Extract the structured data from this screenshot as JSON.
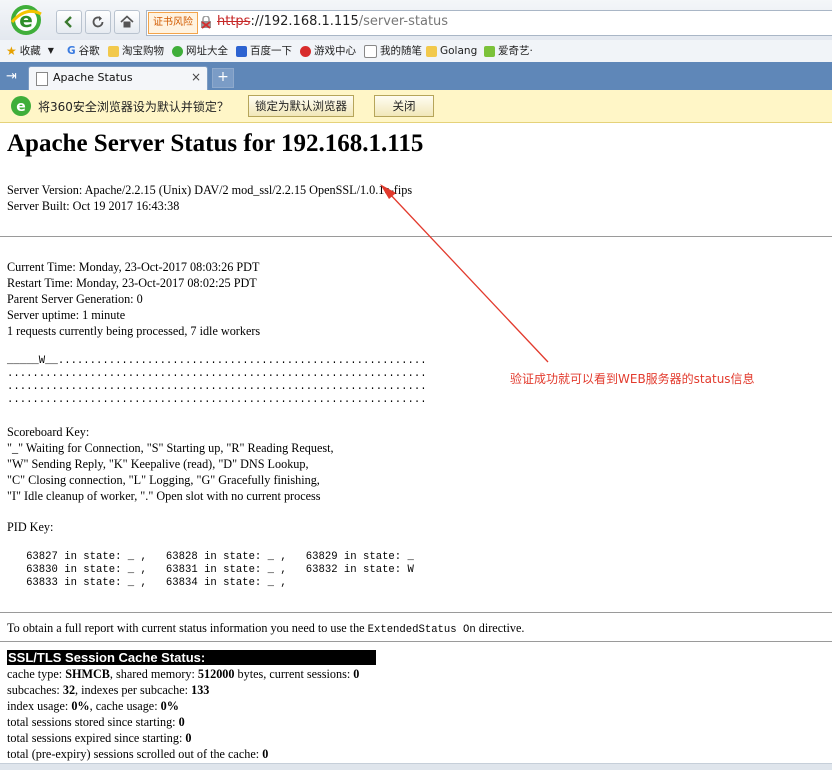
{
  "browser": {
    "cert_warning": "证书风险",
    "url_scheme": "https",
    "url_host": "://192.168.1.115",
    "url_path": "/server-status",
    "bookmarks": [
      "收藏",
      "谷歌",
      "淘宝购物",
      "网址大全",
      "百度一下",
      "游戏中心",
      "我的随笔",
      "Golang",
      "爱奇艺·"
    ],
    "tab_title": "Apache Status",
    "tab_close": "×",
    "new_tab": "+",
    "notify_text": "将360安全浏览器设为默认并锁定？",
    "notify_lock_btn": "锁定为默认浏览器",
    "notify_close_btn": "关闭"
  },
  "page": {
    "title": "Apache Server Status for 192.168.1.115",
    "server_version": "Server Version: Apache/2.2.15 (Unix) DAV/2 mod_ssl/2.2.15 OpenSSL/1.0.1e-fips",
    "server_built": "Server Built: Oct 19 2017 16:43:38",
    "current_time": "Current Time: Monday, 23-Oct-2017 08:03:26 PDT",
    "restart_time": "Restart Time: Monday, 23-Oct-2017 08:02:25 PDT",
    "parent_gen": "Parent Server Generation: 0",
    "uptime": "Server uptime: 1 minute",
    "requests": "1 requests currently being processed, 7 idle workers",
    "scoreboard": [
      "_____W__..........................................................",
      "..................................................................",
      "..................................................................",
      ".................................................................."
    ],
    "scoreboard_key_title": "Scoreboard Key:",
    "scoreboard_key": [
      "\"_\" Waiting for Connection, \"S\" Starting up, \"R\" Reading Request,",
      "\"W\" Sending Reply, \"K\" Keepalive (read), \"D\" DNS Lookup,",
      "\"C\" Closing connection, \"L\" Logging, \"G\" Gracefully finishing,",
      "\"I\" Idle cleanup of worker, \".\" Open slot with no current process"
    ],
    "pid_key_title": "PID Key:",
    "pid_rows": [
      "   63827 in state: _ ,   63828 in state: _ ,   63829 in state: _",
      "   63830 in state: _ ,   63831 in state: _ ,   63832 in state: W",
      "   63833 in state: _ ,   63834 in state: _ ,"
    ],
    "extended_text_before": "To obtain a full report with current status information you need to use the ",
    "extended_code": "ExtendedStatus On",
    "extended_text_after": " directive.",
    "ssl_title": "SSL/TLS Session Cache Status:",
    "ssl_lines": [
      {
        "pre": "cache type: ",
        "b1": "SHMCB",
        "mid": ", shared memory: ",
        "b2": "512000",
        "mid2": " bytes, current sessions: ",
        "b3": "0"
      },
      {
        "pre": "subcaches: ",
        "b1": "32",
        "mid": ", indexes per subcache: ",
        "b2": "133",
        "mid2": "",
        "b3": ""
      },
      {
        "pre": "index usage: ",
        "b1": "0%",
        "mid": ", cache usage: ",
        "b2": "0%",
        "mid2": "",
        "b3": ""
      },
      {
        "pre": "total sessions stored since starting: ",
        "b1": "0",
        "mid": "",
        "b2": "",
        "mid2": "",
        "b3": ""
      },
      {
        "pre": "total sessions expired since starting: ",
        "b1": "0",
        "mid": "",
        "b2": "",
        "mid2": "",
        "b3": ""
      },
      {
        "pre": "total (pre-expiry) sessions scrolled out of the cache: ",
        "b1": "0",
        "mid": "",
        "b2": "",
        "mid2": "",
        "b3": ""
      }
    ]
  },
  "annotation": {
    "text": "验证成功就可以看到WEB服务器的status信息",
    "color": "#e23a2d"
  }
}
